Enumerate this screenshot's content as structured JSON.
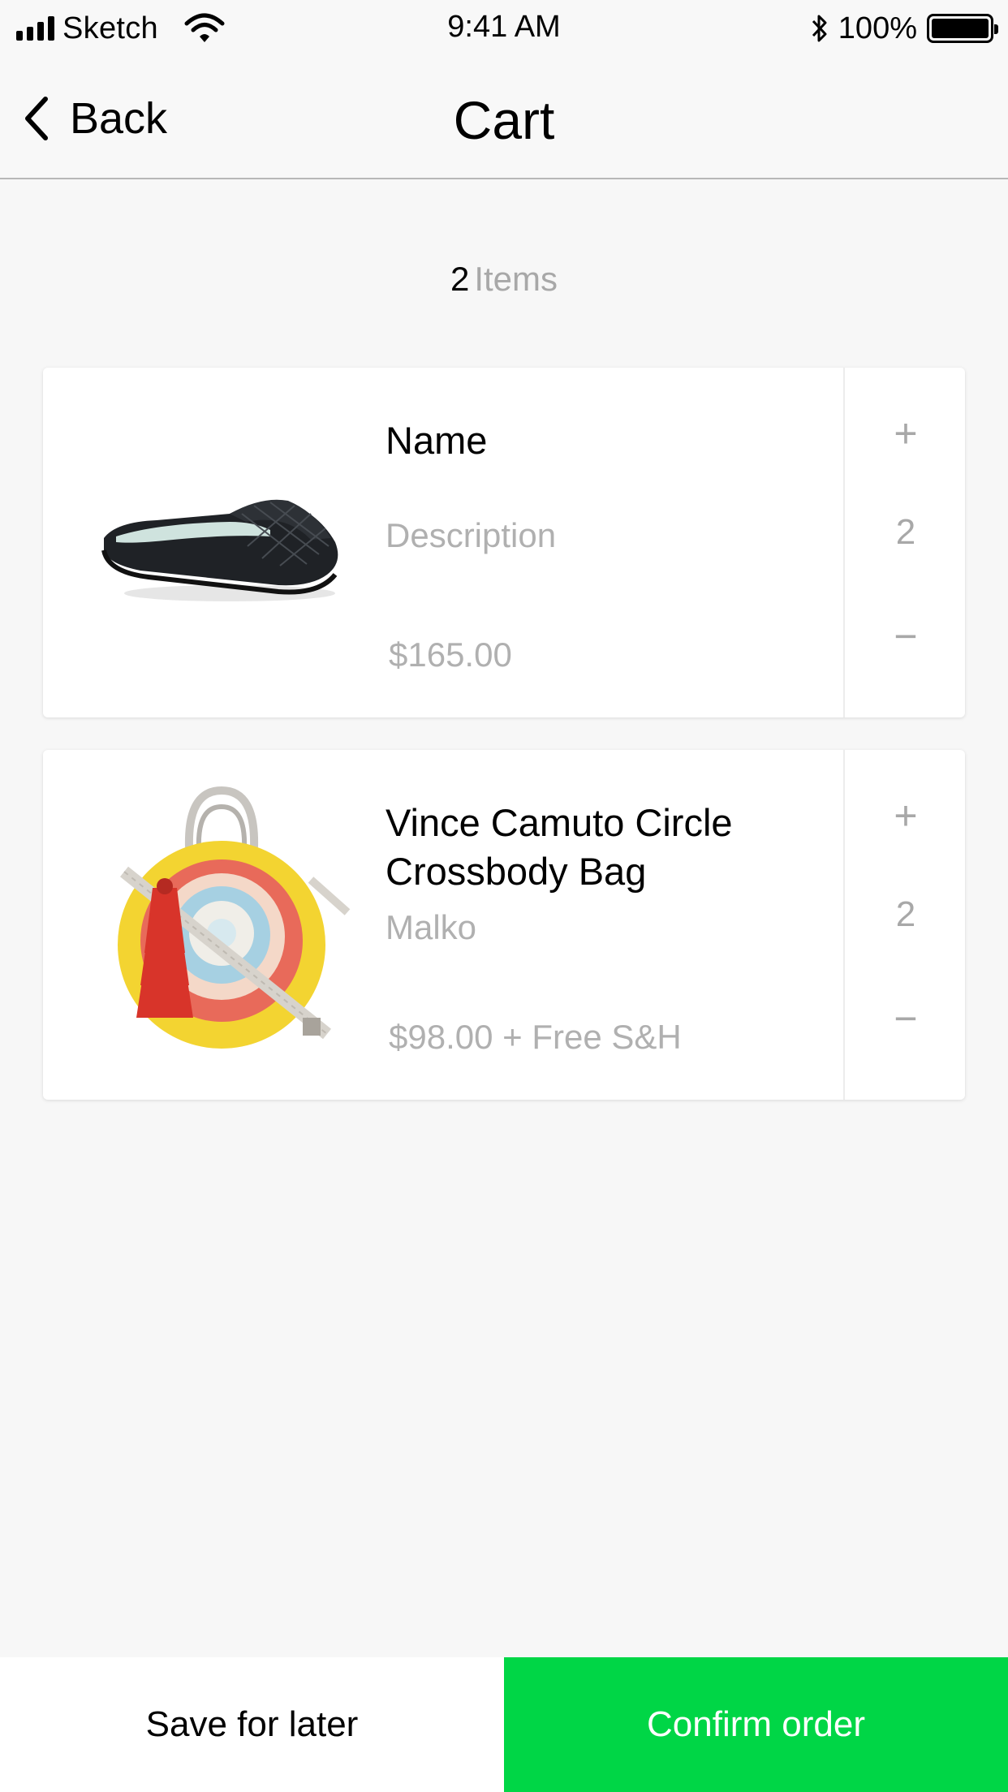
{
  "status_bar": {
    "carrier": "Sketch",
    "time": "9:41 AM",
    "battery_percent": "100%",
    "icons": [
      "signal-icon",
      "wifi-icon",
      "bluetooth-icon",
      "battery-icon"
    ]
  },
  "nav": {
    "back_label": "Back",
    "title": "Cart"
  },
  "summary": {
    "count": "2",
    "label": "Items"
  },
  "cart_items": [
    {
      "image": "loafer-mule-shoe-image",
      "name": "Name",
      "description": "Description",
      "price": "$165.00",
      "plus": "+",
      "quantity": "2",
      "minus": "−"
    },
    {
      "image": "circle-crossbody-bag-image",
      "name": "Vince Camuto Circle Crossbody Bag",
      "description": "Malko",
      "price": "$98.00 + Free S&H",
      "plus": "+",
      "quantity": "2",
      "minus": "−"
    }
  ],
  "actions": {
    "save_label": "Save for later",
    "confirm_label": "Confirm order"
  },
  "colors": {
    "confirm": "#00d646",
    "muted_text": "#b0b0b0",
    "background": "#f7f7f7"
  }
}
